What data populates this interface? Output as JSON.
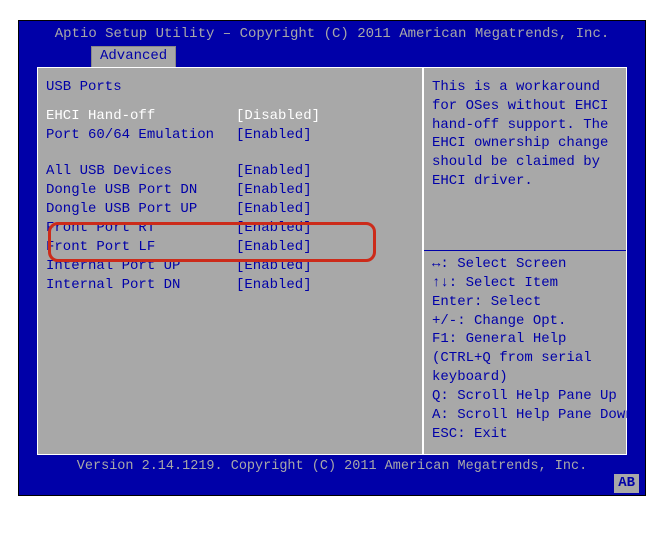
{
  "header": {
    "title": "Aptio Setup Utility – Copyright (C) 2011 American Megatrends, Inc."
  },
  "tabs": [
    {
      "label": "Advanced"
    }
  ],
  "left": {
    "section_title": "USB Ports",
    "rows": [
      {
        "label": "EHCI Hand-off",
        "value": "[Disabled]",
        "selected": true
      },
      {
        "label": "Port 60/64 Emulation",
        "value": "[Enabled]",
        "selected": false
      },
      {
        "label": "",
        "value": "",
        "blank": true
      },
      {
        "label": "All USB Devices",
        "value": "[Enabled]",
        "selected": false
      },
      {
        "label": "Dongle USB Port DN",
        "value": "[Enabled]",
        "selected": false
      },
      {
        "label": "Dongle USB Port UP",
        "value": "[Enabled]",
        "selected": false
      },
      {
        "label": "Front Port RT",
        "value": "[Enabled]",
        "selected": false
      },
      {
        "label": "Front Port LF",
        "value": "[Enabled]",
        "selected": false
      },
      {
        "label": "Internal Port UP",
        "value": "[Enabled]",
        "selected": false
      },
      {
        "label": "Internal Port DN",
        "value": "[Enabled]",
        "selected": false
      }
    ]
  },
  "right": {
    "help": "This is a workaround for OSes without EHCI hand-off support. The EHCI ownership change should be claimed by EHCI driver.",
    "hints": [
      "↔: Select Screen",
      "↑↓: Select Item",
      "Enter: Select",
      "+/-: Change Opt.",
      "F1: General Help",
      "(CTRL+Q from serial",
      "keyboard)",
      "Q: Scroll Help Pane Up",
      "A: Scroll Help Pane Down",
      "ESC: Exit"
    ]
  },
  "footer": {
    "version": "Version 2.14.1219. Copyright (C) 2011 American Megatrends, Inc.",
    "badge": "AB"
  }
}
